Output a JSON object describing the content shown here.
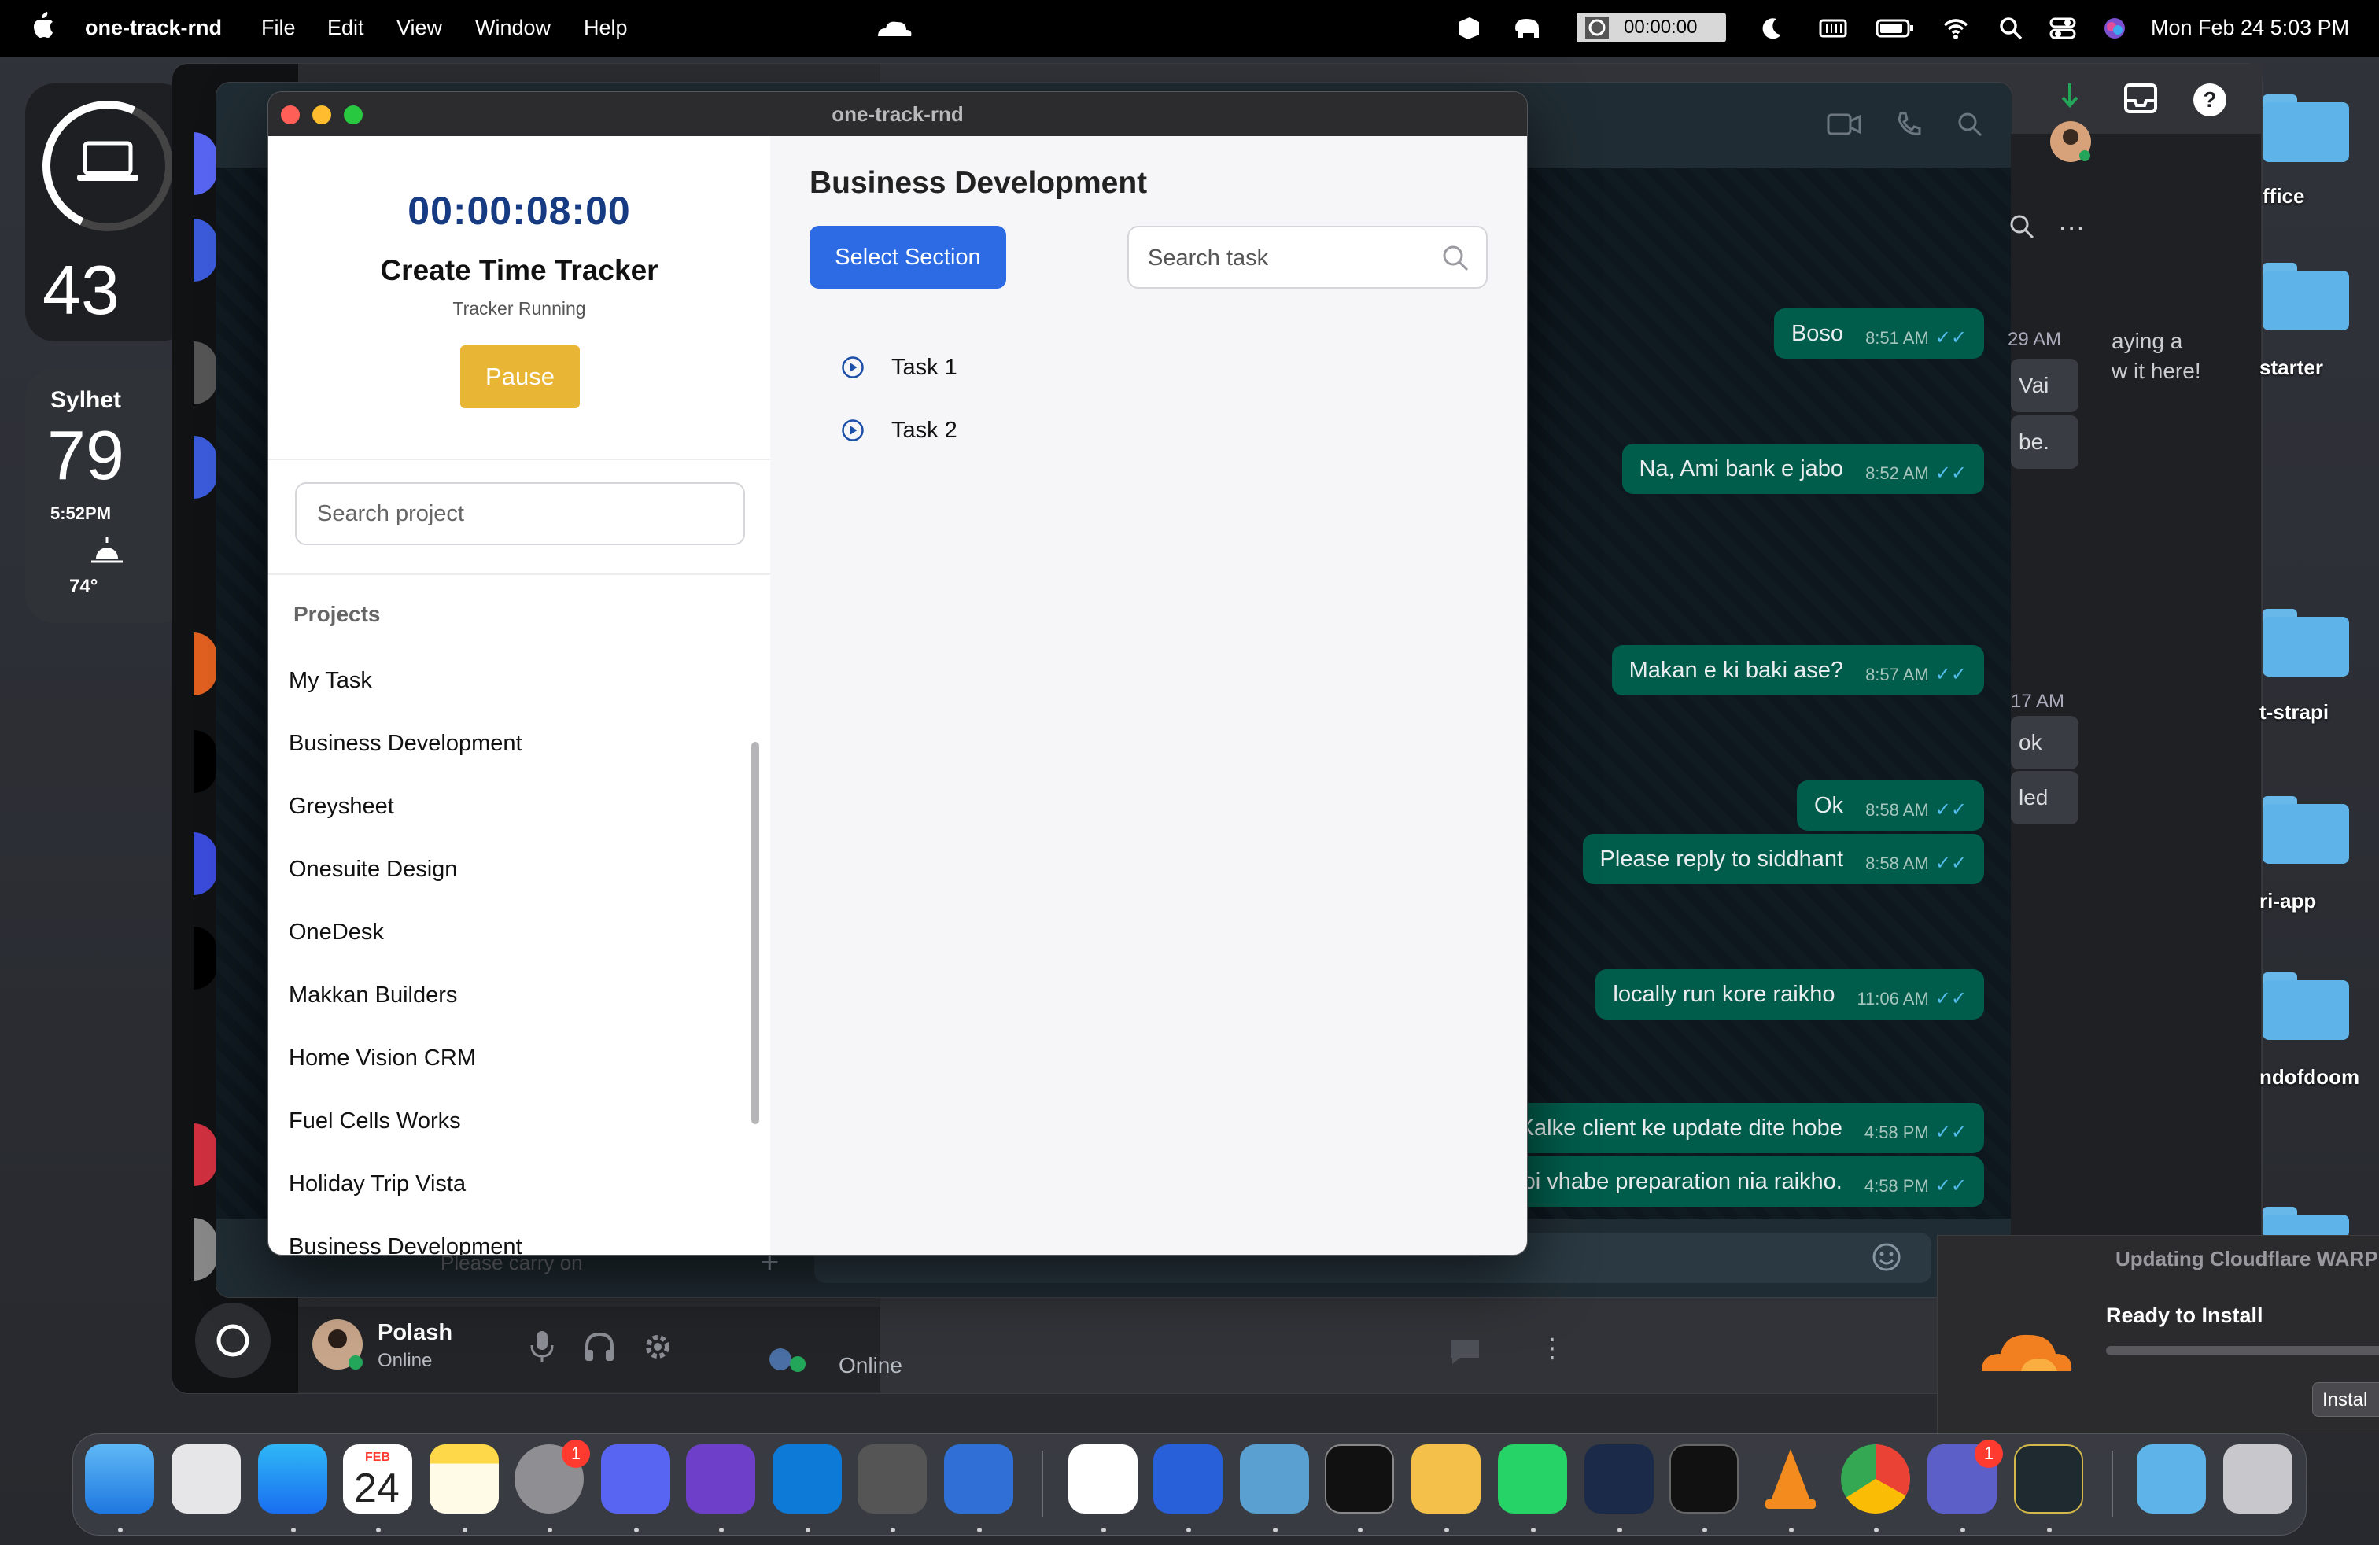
{
  "menubar": {
    "app_name": "one-track-rnd",
    "menus": [
      "File",
      "Edit",
      "View",
      "Window",
      "Help"
    ],
    "timer": "00:00:00",
    "date_time": "Mon Feb 24  5:03 PM"
  },
  "widgets": {
    "battery_percent": "43",
    "weather_city": "Sylhet",
    "weather_temp": "79",
    "weather_time": "5:52PM",
    "weather_high": "74°"
  },
  "chat": {
    "messages": [
      {
        "text": "Boso",
        "time": "8:51 AM"
      },
      {
        "text": "Na, Ami bank e jabo",
        "time": "8:52 AM"
      },
      {
        "text": "Makan e ki baki ase?",
        "time": "8:57 AM"
      },
      {
        "text": "Ok",
        "time": "8:58 AM"
      },
      {
        "text": "Please reply to siddhant",
        "time": "8:58 AM"
      },
      {
        "text": "locally run kore raikho",
        "time": "11:06 AM"
      },
      {
        "text": "Kalke client ke update dite hobe",
        "time": "4:58 PM"
      },
      {
        "text": "oi vhabe preparation nia raikho.",
        "time": "4:58 PM"
      }
    ],
    "side_texts": [
      "29 AM",
      "Vai",
      "be.",
      "17 AM",
      "ok",
      "led",
      "aying a",
      "w it here!"
    ],
    "input_placeholder": "Please carry on",
    "user_name": "Polash",
    "user_status": "Online",
    "status2": "Online"
  },
  "desktop_folders": [
    "ffice",
    "starter",
    "t-strapi",
    "ri-app",
    "ndofdoom"
  ],
  "notification": {
    "title": "Updating Cloudflare WARP",
    "subtitle": "Ready to Install",
    "button": "Instal"
  },
  "dock": {
    "calendar_month": "FEB",
    "calendar_day": "24",
    "badges": [
      "1",
      "1"
    ]
  },
  "app": {
    "window_title": "one-track-rnd",
    "timer": "00:00:08:00",
    "tracker_title": "Create Time Tracker",
    "tracker_status": "Tracker Running",
    "pause_label": "Pause",
    "project_search_placeholder": "Search project",
    "projects_heading": "Projects",
    "projects": [
      "My Task",
      "Business Development",
      "Greysheet",
      "Onesuite Design",
      "OneDesk",
      "Makkan Builders",
      "Home Vision CRM",
      "Fuel Cells Works",
      "Holiday Trip Vista",
      "Business Development"
    ],
    "section_title": "Business Development",
    "select_section_label": "Select Section",
    "task_search_placeholder": "Search task",
    "tasks": [
      "Task 1",
      "Task 2"
    ],
    "colors": {
      "timer": "#163b82",
      "pause": "#e8b634",
      "primary": "#2d6be4"
    }
  }
}
